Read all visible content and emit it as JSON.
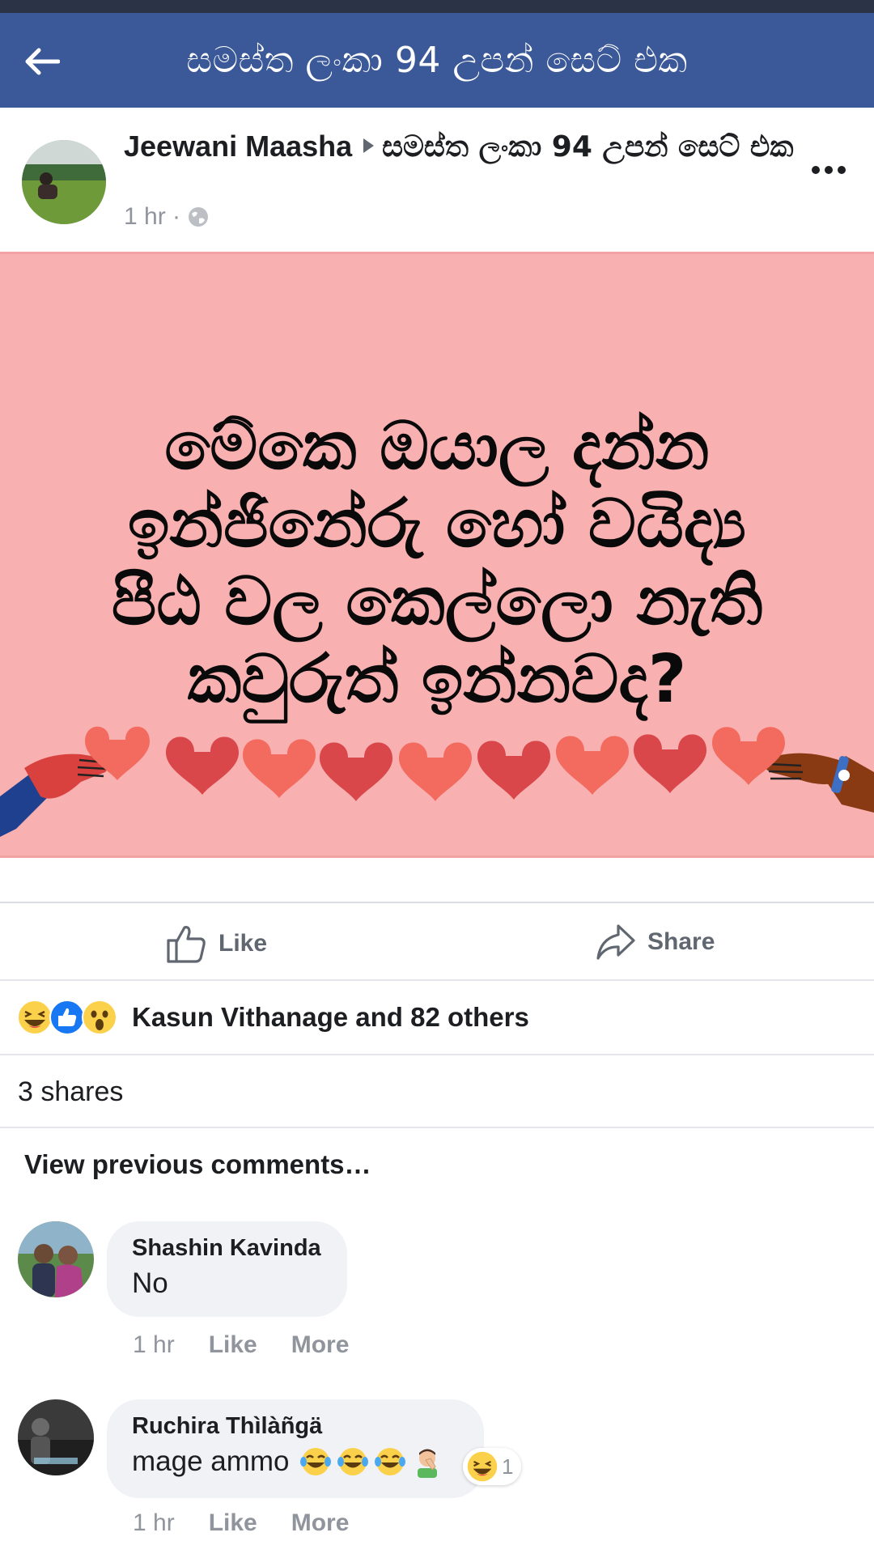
{
  "header": {
    "title": "සමස්ත ලංකා 94 උපන් සෙට් එක",
    "back_icon": "arrow-left-icon",
    "bg_color": "#3b5998"
  },
  "post": {
    "author": "Jeewani Maasha",
    "group": "සමස්ත ලංකා 94 උපන් සෙට් එක",
    "time": "1 hr ·",
    "privacy_icon": "globe-icon",
    "image_text_lines": [
      "මේකෙ ඔයාල දන්න",
      "ඉන්ජිනේරු හෝ වයිද්‍ය",
      "පීඨ වල කෙල්ලො නැති",
      "කවුරුත් ඉන්නවද?"
    ],
    "image_bg_color": "#f8b0b1"
  },
  "actions": {
    "like_label": "Like",
    "share_label": "Share"
  },
  "reactions": {
    "icons": [
      "haha-icon",
      "like-icon",
      "wow-icon"
    ],
    "summary": "Kasun Vithanage and 82 others"
  },
  "shares": {
    "label": "3 shares"
  },
  "comments_section": {
    "view_previous": "View previous comments…"
  },
  "comments": [
    {
      "name": "Shashin Kavinda",
      "text": "No",
      "time": "1 hr",
      "like": "Like",
      "more": "More"
    },
    {
      "name": "Ruchira Thìlàñgä",
      "text": "mage ammo",
      "emojis": [
        "laughing-tears-icon",
        "laughing-tears-icon",
        "laughing-tears-icon",
        "facepalm-man-icon"
      ],
      "reaction_count": "1",
      "reaction_icon": "haha-icon",
      "time": "1 hr",
      "like": "Like",
      "more": "More"
    }
  ]
}
